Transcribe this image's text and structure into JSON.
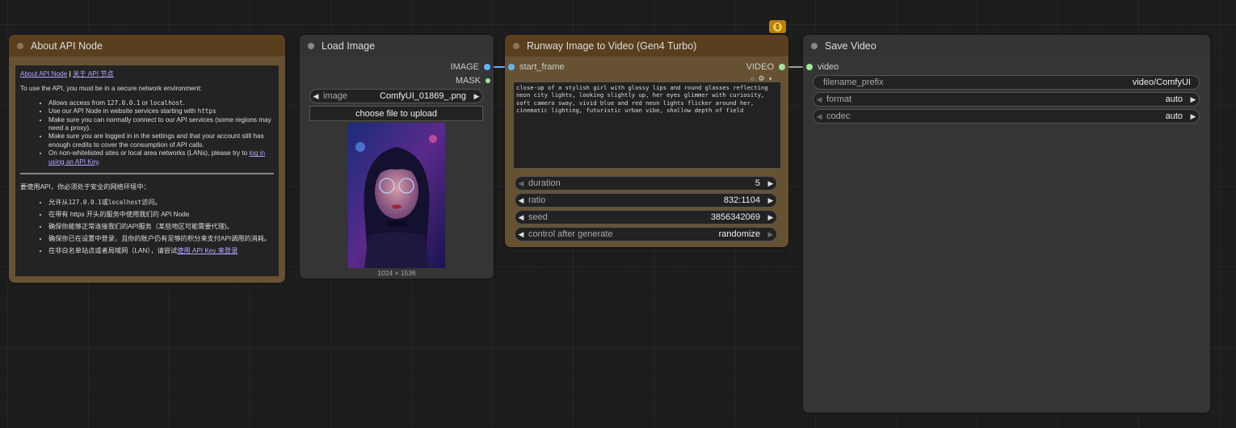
{
  "about_node": {
    "title": "About API Node",
    "link_en": "About API Node",
    "link_sep": "|",
    "link_cn": "关于 API 节点",
    "intro": "To use the API, you must be in a secure network environment:",
    "bullets": [
      {
        "pre": "Allows access from ",
        "code1": "127.0.0.1",
        "mid": " or ",
        "code2": "localhost",
        "post": "."
      },
      {
        "pre": "Use our API Node in website services starting with ",
        "code1": "https"
      },
      {
        "text": "Make sure you can normally connect to our API services (some regions may need a proxy)."
      },
      {
        "text": "Make sure you are logged in in the settings and that your account still has enough credits to cover the consumption of API calls."
      },
      {
        "pre": "On non-whitelisted sites or local area networks (LANs), please try to ",
        "link": "log in using an API Key",
        "post": "."
      }
    ],
    "cn_intro": "要使用API，你必须处于安全的网络环境中：",
    "cn_bullets": [
      {
        "pre": "允许从",
        "code1": "127.0.0.1",
        "mid": "或",
        "code2": "localhost",
        "post": "访问。"
      },
      {
        "text": "在带有 https 开头的服务中使用我们的 API Node"
      },
      {
        "text": "确保你能够正常连接我们的API服务（某些地区可能需要代理)。"
      },
      {
        "text": "确保你已在设置中登录，且你的账户仍有足够的积分来支付API调用的消耗。"
      },
      {
        "pre": "在非白名单站点或者局域网（LAN），请尝试",
        "link": "使用 API Key 来登录"
      }
    ]
  },
  "load_image": {
    "title": "Load Image",
    "outputs": [
      "IMAGE",
      "MASK"
    ],
    "image_label": "image",
    "image_value": "ComfyUI_01869_.png",
    "upload_label": "choose file to upload",
    "dimensions": "1024 × 1536"
  },
  "runway": {
    "title": "Runway Image to Video (Gen4 Turbo)",
    "input": "start_frame",
    "output": "VIDEO",
    "prompt": "close-up of a stylish girl with glossy lips and round glasses reflecting neon city lights, looking slightly up, her eyes glimmer with curiosity, soft camera sway, vivid blue and red neon lights flicker around her, cinematic lighting, futuristic urban vibe, shallow depth of field",
    "widgets": [
      {
        "label": "duration",
        "value": "5"
      },
      {
        "label": "ratio",
        "value": "832:1104"
      },
      {
        "label": "seed",
        "value": "3856342069"
      },
      {
        "label": "control after generate",
        "value": "randomize"
      }
    ],
    "badge_symbol": "$"
  },
  "save_video": {
    "title": "Save Video",
    "input": "video",
    "filename_label": "filename_prefix",
    "filename_value": "video/ComfyUI",
    "widgets": [
      {
        "label": "format",
        "value": "auto"
      },
      {
        "label": "codec",
        "value": "auto"
      }
    ]
  },
  "colors": {
    "api_node_header": "#593f1e",
    "api_node_body": "#665233",
    "default_node_body": "#353535",
    "image_socket": "#64b5f6",
    "video_socket": "#a1e59e",
    "canvas_bg": "#1c1c1c"
  }
}
